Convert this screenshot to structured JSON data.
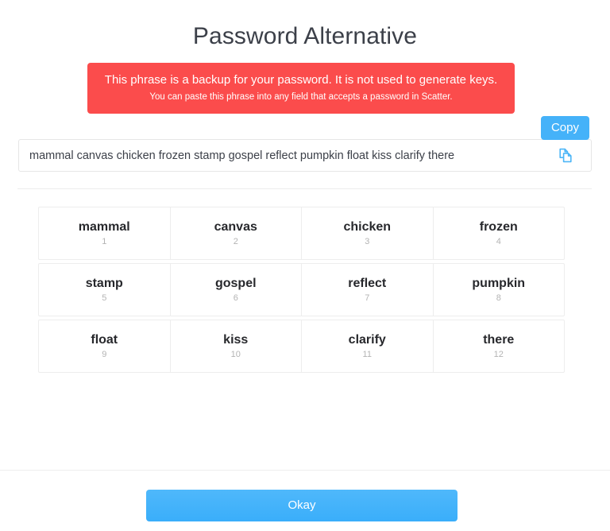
{
  "page": {
    "title": "Password Alternative"
  },
  "alert": {
    "headline": "This phrase is a backup for your password. It is not used to generate keys.",
    "subline": "You can paste this phrase into any field that accepts a password in Scatter.",
    "background_color": "#fb4c4c",
    "text_color": "#ffffff"
  },
  "copy": {
    "tooltip_label": "Copy",
    "tooltip_color": "#45b2f9",
    "icon": "copy-icon",
    "icon_color": "#4db6f7"
  },
  "phrase_field": {
    "value": "mammal canvas chicken frozen stamp gospel reflect pumpkin float kiss clarify there",
    "placeholder": ""
  },
  "word_grid": {
    "rows": [
      [
        {
          "word": "mammal",
          "number": "1"
        },
        {
          "word": "canvas",
          "number": "2"
        },
        {
          "word": "chicken",
          "number": "3"
        },
        {
          "word": "frozen",
          "number": "4"
        }
      ],
      [
        {
          "word": "stamp",
          "number": "5"
        },
        {
          "word": "gospel",
          "number": "6"
        },
        {
          "word": "reflect",
          "number": "7"
        },
        {
          "word": "pumpkin",
          "number": "8"
        }
      ],
      [
        {
          "word": "float",
          "number": "9"
        },
        {
          "word": "kiss",
          "number": "10"
        },
        {
          "word": "clarify",
          "number": "11"
        },
        {
          "word": "there",
          "number": "12"
        }
      ]
    ]
  },
  "footer": {
    "confirm_label": "Okay",
    "confirm_color": "#45b2f9"
  }
}
